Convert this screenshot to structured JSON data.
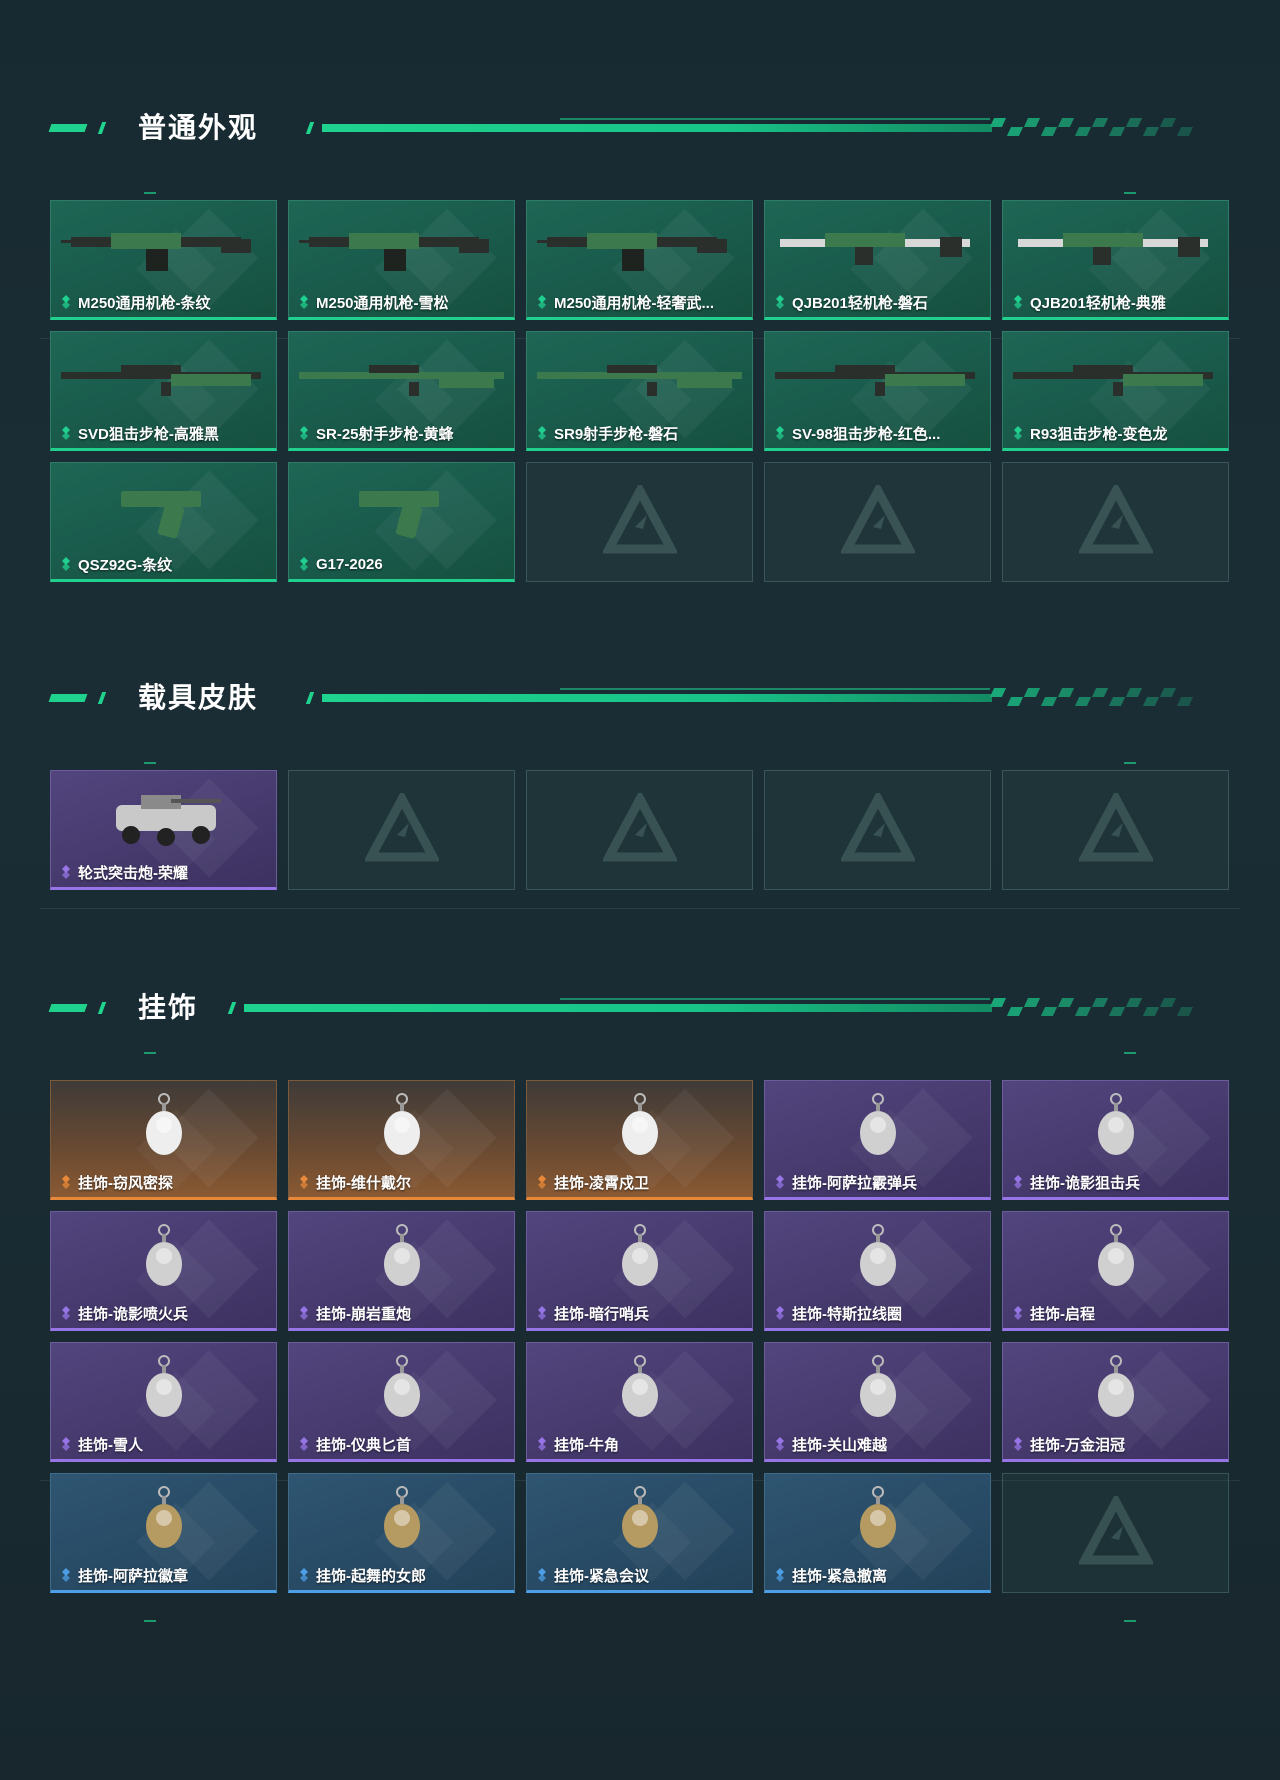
{
  "sections": [
    {
      "title": "普通外观",
      "items": [
        {
          "label": "M250通用机枪-条纹",
          "rarity": "green",
          "icon": "machine-gun"
        },
        {
          "label": "M250通用机枪-雪松",
          "rarity": "green",
          "icon": "machine-gun"
        },
        {
          "label": "M250通用机枪-轻奢武...",
          "rarity": "green",
          "icon": "machine-gun"
        },
        {
          "label": "QJB201轻机枪-磐石",
          "rarity": "green",
          "icon": "light-machine-gun"
        },
        {
          "label": "QJB201轻机枪-典雅",
          "rarity": "green",
          "icon": "light-machine-gun"
        },
        {
          "label": "SVD狙击步枪-高雅黑",
          "rarity": "green",
          "icon": "sniper-rifle"
        },
        {
          "label": "SR-25射手步枪-黄蜂",
          "rarity": "green",
          "icon": "marksman-rifle"
        },
        {
          "label": "SR9射手步枪-磐石",
          "rarity": "green",
          "icon": "marksman-rifle"
        },
        {
          "label": "SV-98狙击步枪-红色...",
          "rarity": "green",
          "icon": "sniper-rifle"
        },
        {
          "label": "R93狙击步枪-变色龙",
          "rarity": "green",
          "icon": "sniper-rifle"
        },
        {
          "label": "QSZ92G-条纹",
          "rarity": "green",
          "icon": "pistol"
        },
        {
          "label": "G17-2026",
          "rarity": "green",
          "icon": "pistol"
        },
        {
          "empty": true
        },
        {
          "empty": true
        },
        {
          "empty": true
        }
      ]
    },
    {
      "title": "载具皮肤",
      "items": [
        {
          "label": "轮式突击炮-荣耀",
          "rarity": "purple",
          "icon": "vehicle"
        },
        {
          "empty": true
        },
        {
          "empty": true
        },
        {
          "empty": true
        },
        {
          "empty": true
        }
      ]
    },
    {
      "title": "挂饰",
      "items": [
        {
          "label": "挂饰-窃风密探",
          "rarity": "orange",
          "icon": "charm"
        },
        {
          "label": "挂饰-维什戴尔",
          "rarity": "orange",
          "icon": "charm"
        },
        {
          "label": "挂饰-凌霄戍卫",
          "rarity": "orange",
          "icon": "charm"
        },
        {
          "label": "挂饰-阿萨拉霰弹兵",
          "rarity": "purple",
          "icon": "charm"
        },
        {
          "label": "挂饰-诡影狙击兵",
          "rarity": "purple",
          "icon": "charm"
        },
        {
          "label": "挂饰-诡影喷火兵",
          "rarity": "purple",
          "icon": "charm"
        },
        {
          "label": "挂饰-崩岩重炮",
          "rarity": "purple",
          "icon": "charm"
        },
        {
          "label": "挂饰-暗行哨兵",
          "rarity": "purple",
          "icon": "charm"
        },
        {
          "label": "挂饰-特斯拉线圈",
          "rarity": "purple",
          "icon": "charm"
        },
        {
          "label": "挂饰-启程",
          "rarity": "purple",
          "icon": "charm"
        },
        {
          "label": "挂饰-雪人",
          "rarity": "purple",
          "icon": "charm"
        },
        {
          "label": "挂饰-仪典匕首",
          "rarity": "purple",
          "icon": "charm"
        },
        {
          "label": "挂饰-牛角",
          "rarity": "purple",
          "icon": "charm"
        },
        {
          "label": "挂饰-关山难越",
          "rarity": "purple",
          "icon": "charm"
        },
        {
          "label": "挂饰-万金泪冠",
          "rarity": "purple",
          "icon": "charm"
        },
        {
          "label": "挂饰-阿萨拉徽章",
          "rarity": "blue",
          "icon": "charm"
        },
        {
          "label": "挂饰-起舞的女郎",
          "rarity": "blue",
          "icon": "charm"
        },
        {
          "label": "挂饰-紧急会议",
          "rarity": "blue",
          "icon": "charm"
        },
        {
          "label": "挂饰-紧急撤离",
          "rarity": "blue",
          "icon": "charm"
        },
        {
          "empty": true
        }
      ]
    }
  ],
  "colors": {
    "accent": "#1fd38f",
    "green": "#21d08f",
    "purple": "#9775e6",
    "orange": "#e8883a",
    "blue": "#4c9ee6"
  }
}
